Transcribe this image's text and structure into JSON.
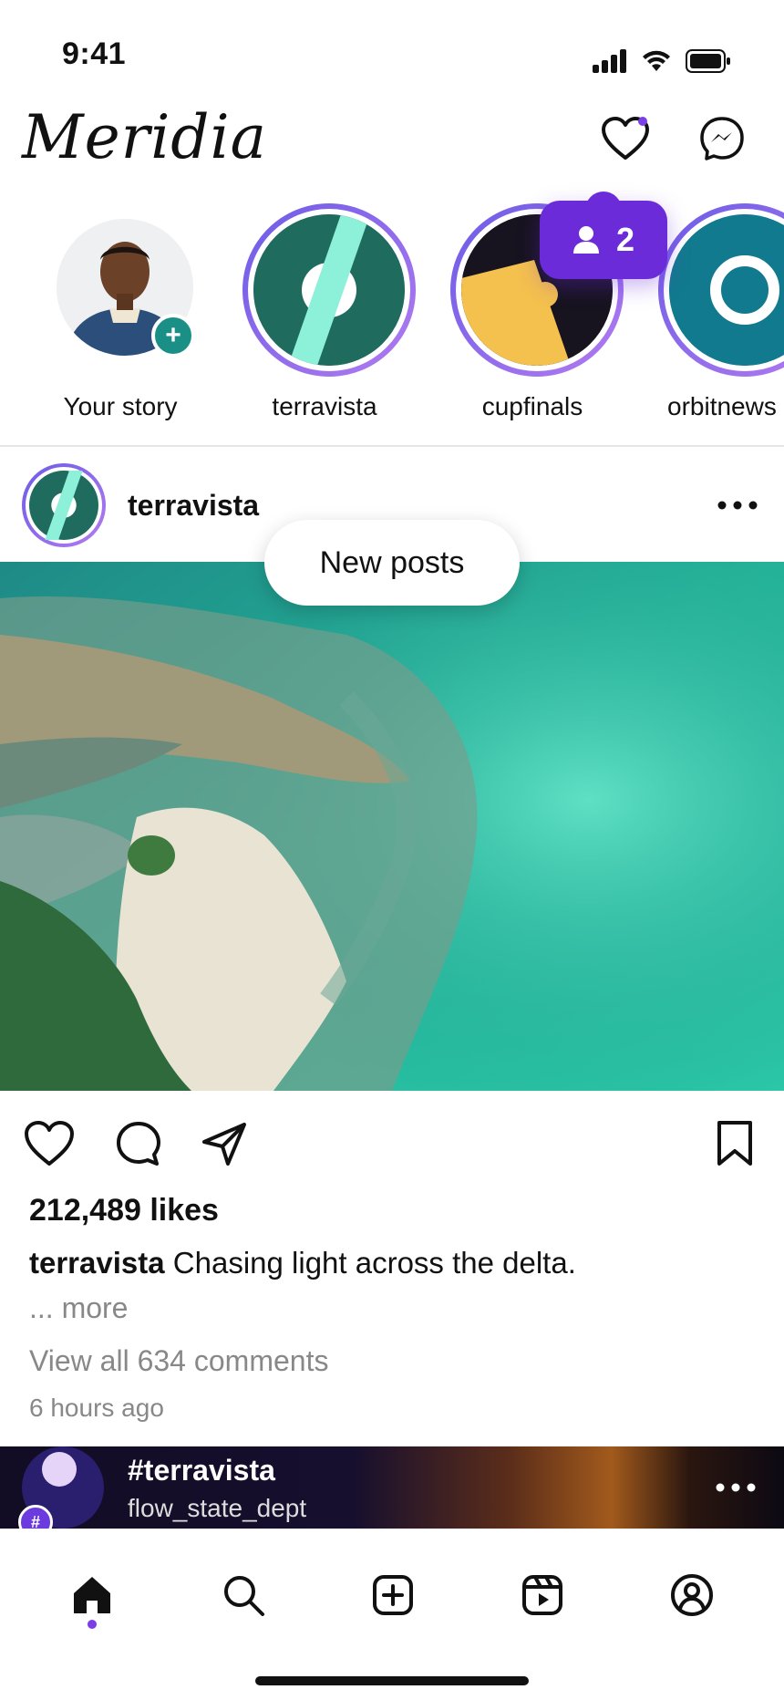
{
  "status_bar": {
    "time": "9:41"
  },
  "header": {
    "logo": "Meridia",
    "activity_icon": "heart-icon",
    "messages_icon": "messenger-icon"
  },
  "stories": [
    {
      "label": "Your story",
      "type": "own"
    },
    {
      "label": "terravista"
    },
    {
      "label": "cupfinals"
    },
    {
      "label": "orbitnews"
    }
  ],
  "story_badge": {
    "count": "2",
    "icon": "person-icon"
  },
  "new_posts_label": "New posts",
  "post": {
    "username": "terravista",
    "likes": "212,489 likes",
    "caption_user": "terravista",
    "caption_text": "Chasing light across the delta.",
    "more_label": "... more",
    "comments_label": "View all 634 comments",
    "time_ago": "6 hours ago"
  },
  "player": {
    "title": "#terravista",
    "subtitle": "flow_state_dept",
    "tag": "#"
  },
  "nav": {
    "items": [
      "home",
      "search",
      "create",
      "reels",
      "profile"
    ],
    "active": "home"
  },
  "colors": {
    "accent": "#7b3fe4",
    "badge": "#6b2bd9"
  }
}
